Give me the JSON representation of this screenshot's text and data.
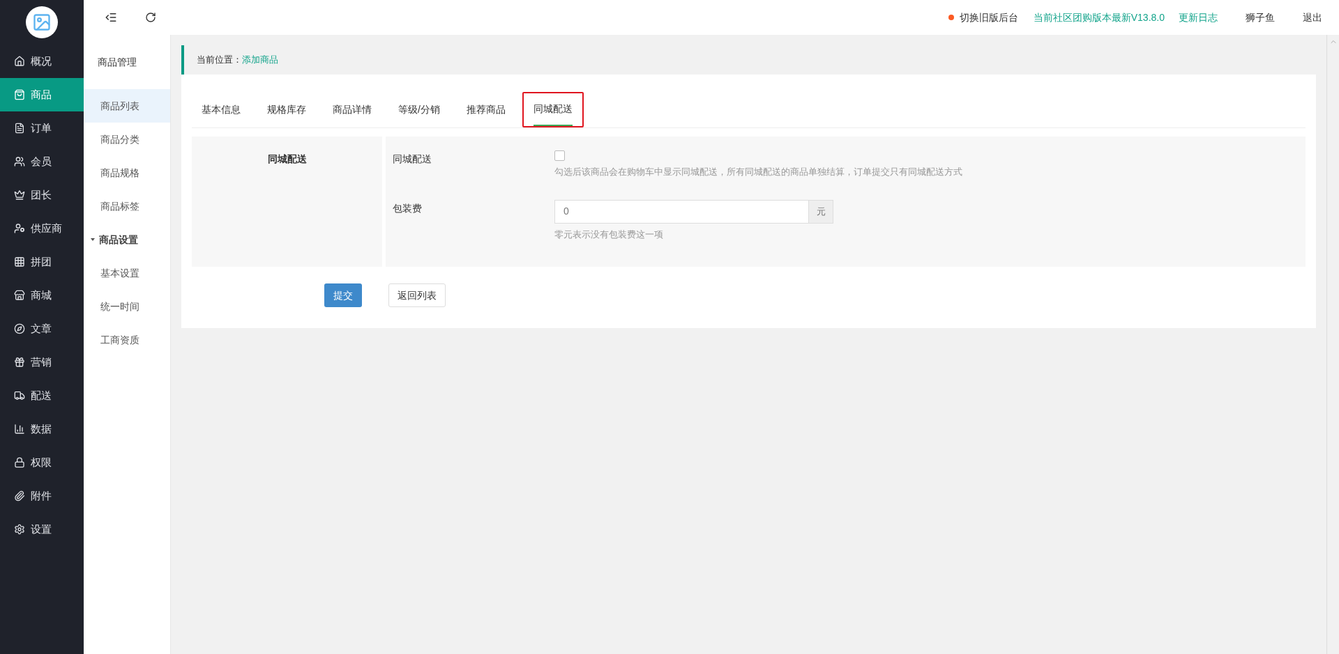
{
  "nav": [
    {
      "label": "概况",
      "selected": false
    },
    {
      "label": "商品",
      "selected": true
    },
    {
      "label": "订单",
      "selected": false
    },
    {
      "label": "会员",
      "selected": false
    },
    {
      "label": "团长",
      "selected": false
    },
    {
      "label": "供应商",
      "selected": false
    },
    {
      "label": "拼团",
      "selected": false
    },
    {
      "label": "商城",
      "selected": false
    },
    {
      "label": "文章",
      "selected": false
    },
    {
      "label": "营销",
      "selected": false
    },
    {
      "label": "配送",
      "selected": false
    },
    {
      "label": "数据",
      "selected": false
    },
    {
      "label": "权限",
      "selected": false
    },
    {
      "label": "附件",
      "selected": false
    },
    {
      "label": "设置",
      "selected": false
    }
  ],
  "subnav": {
    "title": "商品管理",
    "items": [
      {
        "label": "商品列表",
        "selected": true
      },
      {
        "label": "商品分类",
        "selected": false
      },
      {
        "label": "商品规格",
        "selected": false
      },
      {
        "label": "商品标签",
        "selected": false
      }
    ],
    "group": {
      "label": "商品设置",
      "expanded": true,
      "items": [
        {
          "label": "基本设置",
          "selected": false
        },
        {
          "label": "统一时间",
          "selected": false
        },
        {
          "label": "工商资质",
          "selected": false
        }
      ]
    }
  },
  "header": {
    "switch_link": "切换旧版后台",
    "version": "当前社区团购版本最新V13.8.0",
    "changelog": "更新日志",
    "user": "狮子鱼",
    "logout": "退出"
  },
  "breadcrumb": {
    "label": "当前位置：",
    "current": "添加商品"
  },
  "tabs": [
    {
      "label": "基本信息",
      "selected": false
    },
    {
      "label": "规格库存",
      "selected": false
    },
    {
      "label": "商品详情",
      "selected": false
    },
    {
      "label": "等级/分销",
      "selected": false
    },
    {
      "label": "推荐商品",
      "selected": false
    },
    {
      "label": "同城配送",
      "selected": true
    }
  ],
  "section": {
    "title": "同城配送",
    "fields": [
      {
        "kind": "checkbox",
        "label": "同城配送",
        "checked": false,
        "help": "勾选后该商品会在购物车中显示同城配送，所有同城配送的商品单独结算，订单提交只有同城配送方式"
      },
      {
        "kind": "input",
        "label": "包装费",
        "value": "0",
        "addon": "元",
        "help": "零元表示没有包装费这一项"
      }
    ]
  },
  "buttons": {
    "submit": "提交",
    "back": "返回列表"
  }
}
